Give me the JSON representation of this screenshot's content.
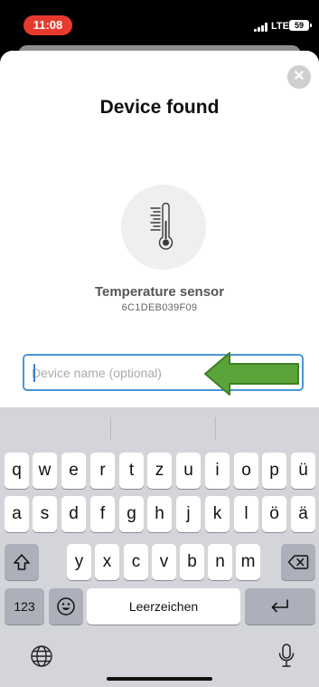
{
  "status_bar": {
    "time": "11:08",
    "network": "LTE",
    "battery": "59"
  },
  "sheet": {
    "title": "Device found",
    "close_icon": "close-icon",
    "device": {
      "icon": "thermometer-icon",
      "name": "Temperature sensor",
      "id": "6C1DEB039F09"
    },
    "name_input": {
      "placeholder": "Device name (optional)",
      "value": ""
    },
    "annotation": {
      "icon": "arrow-left-icon",
      "color": "#5aa43a"
    }
  },
  "keyboard": {
    "row1": [
      "q",
      "w",
      "e",
      "r",
      "t",
      "z",
      "u",
      "i",
      "o",
      "p",
      "ü"
    ],
    "row2": [
      "a",
      "s",
      "d",
      "f",
      "g",
      "h",
      "j",
      "k",
      "l",
      "ö",
      "ä"
    ],
    "row3": [
      "y",
      "x",
      "c",
      "v",
      "b",
      "n",
      "m"
    ],
    "numbers_label": "123",
    "space_label": "Leerzeichen",
    "icons": {
      "shift": "shift-icon",
      "delete": "delete-icon",
      "emoji": "emoji-icon",
      "return": "return-icon",
      "globe": "globe-icon",
      "mic": "microphone-icon"
    }
  },
  "colors": {
    "time_pill": "#e8392f",
    "input_border": "#4a96d8",
    "arrow": "#5aa43a"
  }
}
